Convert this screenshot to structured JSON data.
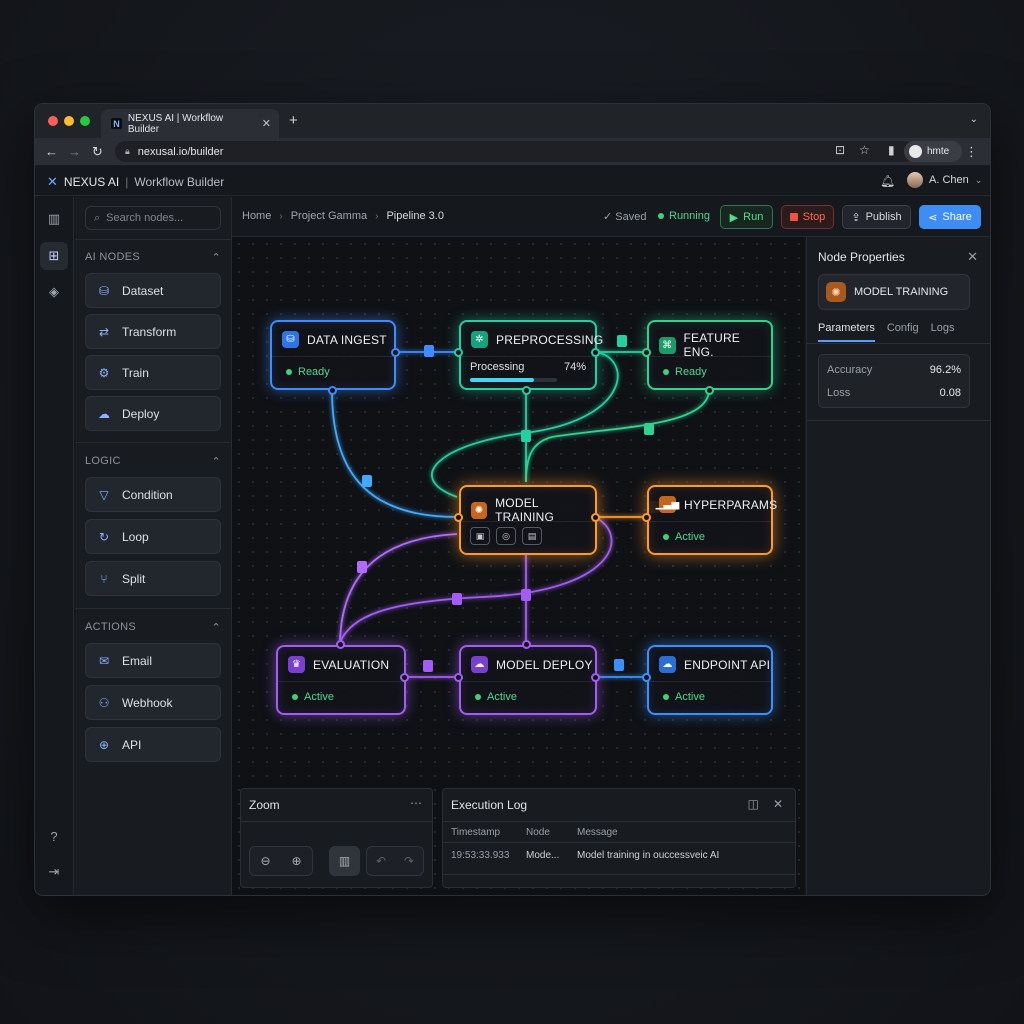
{
  "browser": {
    "tab_title": "NEXUS AI | Workflow Builder",
    "tab_logo": "N",
    "url": "nexusal.io/builder",
    "profile_label": "hmte"
  },
  "app": {
    "brand": "NEXUS AI",
    "separator": "|",
    "subtitle": "Workflow Builder",
    "user_name": "A. Chen"
  },
  "sidebar": {
    "search_placeholder": "Search nodes...",
    "sections": [
      {
        "title": "AI NODES",
        "items": [
          {
            "label": "Dataset",
            "icon": "database-icon",
            "glyph": "⛁"
          },
          {
            "label": "Transform",
            "icon": "transform-icon",
            "glyph": "⇄"
          },
          {
            "label": "Train",
            "icon": "gear-icon",
            "glyph": "⚙"
          },
          {
            "label": "Deploy",
            "icon": "cloud-upload-icon",
            "glyph": "☁"
          }
        ]
      },
      {
        "title": "LOGIC",
        "items": [
          {
            "label": "Condition",
            "icon": "filter-icon",
            "glyph": "▽"
          },
          {
            "label": "Loop",
            "icon": "loop-icon",
            "glyph": "↻"
          },
          {
            "label": "Split",
            "icon": "split-icon",
            "glyph": "⑂"
          }
        ]
      },
      {
        "title": "ACTIONS",
        "items": [
          {
            "label": "Email",
            "icon": "mail-icon",
            "glyph": "✉"
          },
          {
            "label": "Webhook",
            "icon": "webhook-icon",
            "glyph": "⚇"
          },
          {
            "label": "API",
            "icon": "globe-icon",
            "glyph": "⊕"
          }
        ]
      }
    ]
  },
  "toolbar": {
    "breadcrumbs": [
      "Home",
      "Project Gamma",
      "Pipeline 3.0"
    ],
    "saved_label": "Saved",
    "running_label": "Running",
    "run_label": "Run",
    "stop_label": "Stop",
    "publish_label": "Publish",
    "share_label": "Share"
  },
  "nodes": {
    "data_ingest": {
      "title": "DATA INGEST",
      "status": "Ready"
    },
    "preprocessing": {
      "title": "PREPROCESSING",
      "progress_label": "Processing",
      "progress_text": "74%",
      "progress": 0.74
    },
    "feature_eng": {
      "title": "FEATURE ENG.",
      "status": "Ready"
    },
    "model_training": {
      "title": "MODEL TRAINING"
    },
    "hyperparams": {
      "title": "HYPERPARAMS",
      "status": "Active"
    },
    "evaluation": {
      "title": "EVALUATION",
      "status": "Active"
    },
    "model_deploy": {
      "title": "MODEL DEPLOY",
      "status": "Active"
    },
    "endpoint_api": {
      "title": "ENDPOINT API",
      "status": "Active"
    }
  },
  "zoom_panel": {
    "title": "Zoom"
  },
  "log_panel": {
    "title": "Execution Log",
    "columns": [
      "Timestamp",
      "Node",
      "Message"
    ],
    "rows": [
      {
        "timestamp": "19:53:33.933",
        "node": "Mode...",
        "message": "Model training in ouccessveic AI"
      }
    ]
  },
  "properties": {
    "title": "Node Properties",
    "node_name": "MODEL TRAINING",
    "tabs": [
      "Parameters",
      "Config",
      "Logs"
    ],
    "active_tab": "Parameters",
    "metrics": [
      {
        "label": "Accuracy",
        "value": "96.2%"
      },
      {
        "label": "Loss",
        "value": "0.08"
      }
    ]
  },
  "colors": {
    "accent_blue": "#3f8cff",
    "teal": "#24d0a2",
    "orange": "#ff9a2e",
    "purple": "#a45cf6",
    "running_green": "#3fd17f",
    "stop_red": "#f0543f"
  }
}
